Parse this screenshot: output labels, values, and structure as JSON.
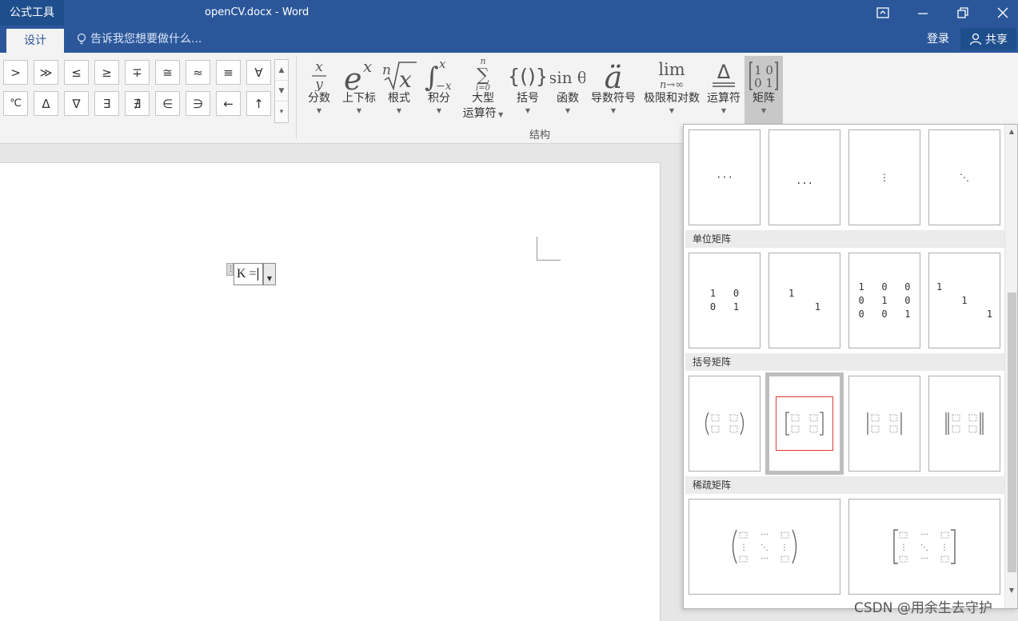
{
  "title_bar": {
    "context_tab": "公式工具",
    "document_title": "openCV.docx - Word"
  },
  "ribbon_tabs": {
    "active_tab": "设计",
    "tell_me": "告诉我您想要做什么...",
    "login": "登录",
    "share": "共享"
  },
  "symbols": {
    "row1": [
      ">",
      "≫",
      "≤",
      "≥",
      "∓",
      "≅",
      "≈",
      "≡",
      "∀"
    ],
    "row2": [
      "℃",
      "Δ",
      "∇",
      "∃",
      "∄",
      "∈",
      "∋",
      "←",
      "↑"
    ]
  },
  "structures": {
    "buttons": [
      {
        "label": "分数",
        "icon": "fraction-icon"
      },
      {
        "label": "上下标",
        "icon": "script-icon"
      },
      {
        "label": "根式",
        "icon": "radical-icon"
      },
      {
        "label": "积分",
        "icon": "integral-icon"
      },
      {
        "label": "大型运算符",
        "line1": "大型",
        "line2": "运算符",
        "icon": "large-operator-icon"
      },
      {
        "label": "括号",
        "icon": "bracket-icon"
      },
      {
        "label": "函数",
        "icon": "function-icon"
      },
      {
        "label": "导数符号",
        "icon": "accent-icon"
      },
      {
        "label": "极限和对数",
        "icon": "limit-icon"
      },
      {
        "label": "运算符",
        "icon": "operator-icon"
      },
      {
        "label": "矩阵",
        "icon": "matrix-icon",
        "active": true
      }
    ],
    "group_label": "结构"
  },
  "equation": {
    "text": "K ="
  },
  "matrix_panel": {
    "sections": [
      {
        "heading": "单位矩阵"
      },
      {
        "heading": "括号矩阵"
      },
      {
        "heading": "稀疏矩阵"
      }
    ],
    "dots": {
      "h": "···",
      "baseline": "...",
      "v": "⋮",
      "d": "⋱"
    },
    "identity_2x2": [
      [
        "1",
        "0"
      ],
      [
        "0",
        "1"
      ]
    ],
    "identity_diag_2": [
      "1",
      "1"
    ],
    "identity_3x3": [
      [
        "1",
        "0",
        "0"
      ],
      [
        "0",
        "1",
        "0"
      ],
      [
        "0",
        "0",
        "1"
      ]
    ],
    "identity_diag_3": [
      "1",
      "1",
      "1"
    ],
    "selected_tile": "bracket-matrix-square"
  },
  "watermark": "CSDN @用余生去守护",
  "colors": {
    "accent": "#2b579a",
    "selected_border": "#e03a2f"
  }
}
